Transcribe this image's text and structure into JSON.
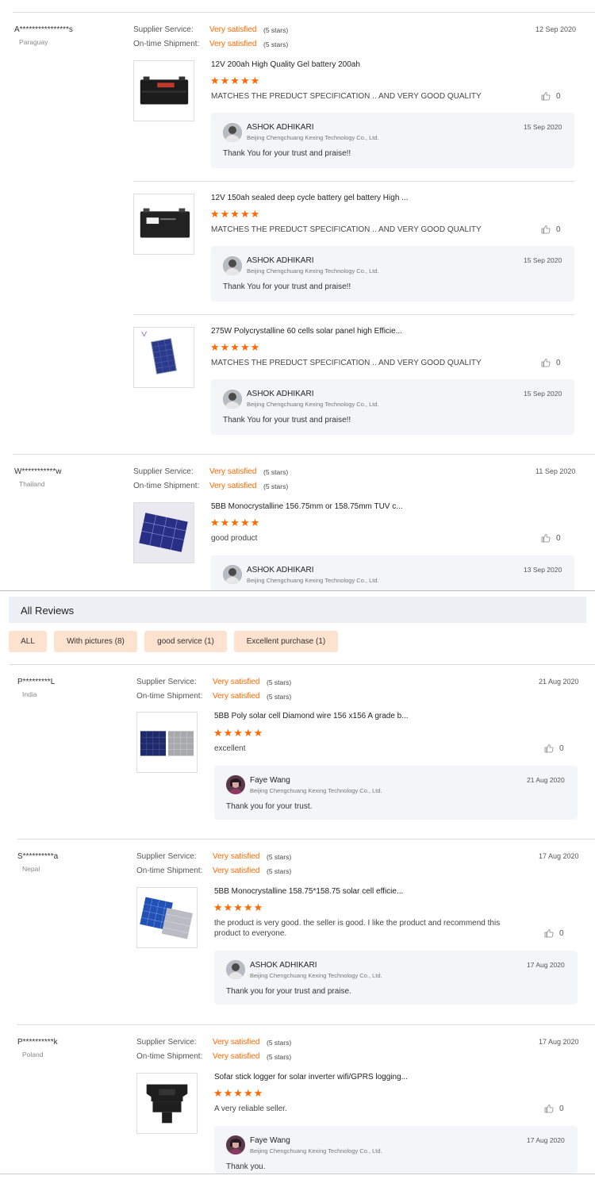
{
  "labels": {
    "supplier_service": "Supplier Service:",
    "ontime_shipment": "On-time Shipment:",
    "very_satisfied": "Very satisfied",
    "five_stars": "(5 stars)",
    "star_glyphs": "★★★★★"
  },
  "top_reviews": [
    {
      "buyer": "A****************s",
      "country": "Paraguay",
      "date": "12 Sep 2020",
      "items": [
        {
          "product": "12V 200ah High Quality Gel battery 200ah",
          "text": "MATCHES THE PREDUCT SPECIFICATION .. AND VERY GOOD QUALITY",
          "likes": "0",
          "reply": {
            "name": "ASHOK ADHIKARI",
            "company": "Beijing Chengchuang Kexing Technology Co., Ltd.",
            "date": "15 Sep 2020",
            "message": "Thank You for your trust and praise!!"
          }
        },
        {
          "product": "12V 150ah sealed deep cycle battery gel battery High ...",
          "text": "MATCHES THE PREDUCT SPECIFICATION .. AND VERY GOOD QUALITY",
          "likes": "0",
          "reply": {
            "name": "ASHOK ADHIKARI",
            "company": "Beijing Chengchuang Kexing Technology Co., Ltd.",
            "date": "15 Sep 2020",
            "message": "Thank You for your trust and praise!!"
          }
        },
        {
          "product": "275W Polycrystalline 60 cells solar panel high Efficie...",
          "text": "MATCHES THE PREDUCT SPECIFICATION .. AND VERY GOOD QUALITY",
          "likes": "0",
          "reply": {
            "name": "ASHOK ADHIKARI",
            "company": "Beijing Chengchuang Kexing Technology Co., Ltd.",
            "date": "15 Sep 2020",
            "message": "Thank You for your trust and praise!!"
          }
        }
      ]
    },
    {
      "buyer": "W***********w",
      "country": "Thailand",
      "date": "11 Sep 2020",
      "items": [
        {
          "product": "5BB Monocrystalline 156.75mm or 158.75mm TUV c...",
          "text": "good product",
          "likes": "0",
          "reply": {
            "name": "ASHOK ADHIKARI",
            "company": "Beijing Chengchuang Kexing Technology Co., Ltd.",
            "date": "13 Sep 2020"
          }
        }
      ]
    }
  ],
  "all_reviews": {
    "title": "All Reviews",
    "filters": [
      "ALL",
      "With pictures (8)",
      "good service (1)",
      "Excellent purchase (1)"
    ],
    "reviews": [
      {
        "buyer": "P*********L",
        "country": "India",
        "date": "21 Aug 2020",
        "product": "5BB Poly solar cell Diamond wire 156 x156 A grade b...",
        "text": "excellent",
        "likes": "0",
        "reply": {
          "name": "Faye Wang",
          "company": "Beijing Chengchuang Kexing Technology Co., Ltd.",
          "date": "21 Aug 2020",
          "message": "Thank you for your trust."
        }
      },
      {
        "buyer": "S**********a",
        "country": "Nepal",
        "date": "17 Aug 2020",
        "product": "5BB Monocrystalline 158.75*158.75 solar cell efficie...",
        "text_line1": "the product is very good. the seller is good. I like the product and recommend this",
        "text_line2": "product to everyone.",
        "likes": "0",
        "reply": {
          "name": "ASHOK ADHIKARI",
          "company": "Beijing Chengchuang Kexing Technology Co., Ltd.",
          "date": "17 Aug 2020",
          "message": "Thank you for your trust and praise."
        }
      },
      {
        "buyer": "P**********k",
        "country": "Poland",
        "date": "17 Aug 2020",
        "product": "Sofar stick logger for solar inverter wifi/GPRS logging...",
        "text": "A very reliable seller.",
        "likes": "0",
        "reply": {
          "name": "Faye Wang",
          "company": "Beijing Chengchuang Kexing Technology Co., Ltd.",
          "date": "17 Aug 2020",
          "message": "Thank you."
        }
      }
    ]
  },
  "colors": {
    "accent": "#ff6a00",
    "filter_bg": "#fde2cf",
    "reply_bg": "#f4f5f7"
  },
  "icons": [
    "thumbs-up-icon",
    "avatar-icon"
  ]
}
